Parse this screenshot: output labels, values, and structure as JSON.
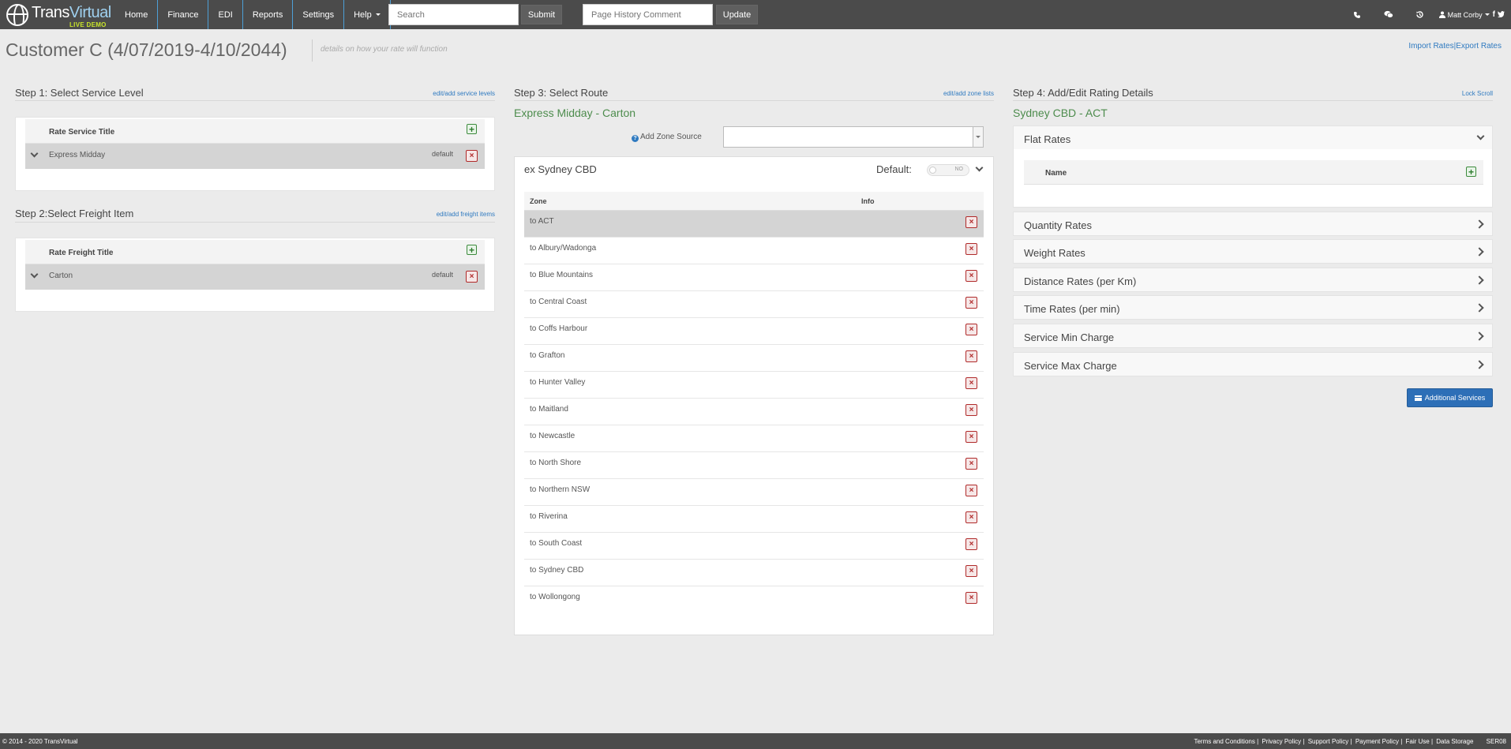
{
  "topbar": {
    "logo_trans": "Trans",
    "logo_virtual": "Virtual",
    "logo_demo": "LIVE DEMO",
    "nav": [
      "Home",
      "Finance",
      "EDI",
      "Reports",
      "Settings",
      "Help"
    ],
    "search_placeholder": "Search",
    "submit_label": "Submit",
    "history_placeholder": "Page History Comment",
    "update_label": "Update",
    "user_name": "Matt Corby"
  },
  "header": {
    "title": "Customer C (4/07/2019-4/10/2044)",
    "note": "details on how your rate will function",
    "import_rates": "Import Rates",
    "separator": "|",
    "export_rates": "Export Rates"
  },
  "step1": {
    "title": "Step 1: Select Service Level",
    "link": "edit/add service levels",
    "header": "Rate Service Title",
    "row_label": "Express Midday",
    "row_default": "default"
  },
  "step2": {
    "title": "Step 2:Select Freight Item",
    "link": "edit/add freight items",
    "header": "Rate Freight Title",
    "row_label": "Carton",
    "row_default": "default"
  },
  "step3": {
    "title": "Step 3: Select Route",
    "link": "edit/add zone lists",
    "route": "Express Midday - Carton",
    "zone_source_label": "Add Zone Source",
    "panel_title": "ex Sydney CBD",
    "default_label": "Default:",
    "toggle_text": "NO",
    "col_zone": "Zone",
    "col_info": "Info",
    "zones": [
      "to ACT",
      "to Albury/Wadonga",
      "to Blue Mountains",
      "to Central Coast",
      "to Coffs Harbour",
      "to Grafton",
      "to Hunter Valley",
      "to Maitland",
      "to Newcastle",
      "to North Shore",
      "to Northern NSW",
      "to Riverina",
      "to South Coast",
      "to Sydney CBD",
      "to Wollongong"
    ]
  },
  "step4": {
    "title": "Step 4: Add/Edit Rating Details",
    "link": "Lock Scroll",
    "route": "Sydney CBD - ACT",
    "flat_rates": "Flat Rates",
    "flat_name_header": "Name",
    "sections": [
      "Quantity Rates",
      "Weight Rates",
      "Distance Rates (per Km)",
      "Time Rates (per min)",
      "Service Min Charge",
      "Service Max Charge"
    ],
    "additional_services": "Additional Services"
  },
  "footer": {
    "copyright": "© 2014 - 2020 TransVirtual",
    "terms": "Terms and Conditions",
    "privacy": "Privacy Policy",
    "support": "Support Policy",
    "payment": "Payment Policy",
    "fair_use": "Fair Use",
    "data_storage": "Data Storage",
    "server": "SER08"
  }
}
